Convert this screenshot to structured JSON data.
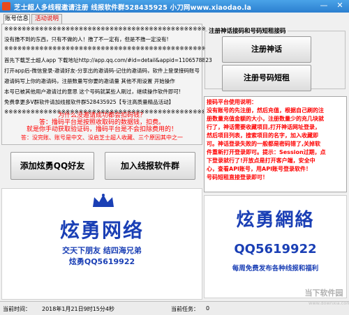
{
  "window": {
    "title": "芝士超人多线程邀请注册    线报软件群528435925    小刀网www.xiaodao.la",
    "minimize_glyph": "—",
    "close_glyph": "✕"
  },
  "tabs": [
    {
      "label": "账号信息"
    },
    {
      "label": "活动说明"
    }
  ],
  "left_panel": {
    "lines": [
      "※※※※※※※※※※※※※※※※※※※※※※※※※※※※※※※※※※※※※※※※※※※※※※",
      "没有撸不到的东西，只有不做的人！撸了不一定有，但是不撸一定没有!",
      "※※※※※※※※※※※※※※※※※※※※※※※※※※※※※※※※※※※※※※※※※※※※※※",
      "首先下载芝士超人app 下载地址http://app.qq.com/#id=detail&appid=1106578823",
      "打开app后-微信登录-邀请好友-分享出的邀请码-记住的邀请码，软件上登录接码账号",
      "邀请码写上你的邀请码，注册数量写你要的邀请量 其他不用设置 开始操作",
      "本号已被其他用户邀请过的意思 这个号码就某些人刷过，继续操作软件即可!",
      "免费拿更多V群软件请加线报软件群528435925【专注高质量精品活动】",
      "※※※※※※※※※※※※※※※※※※※※※※※※※※※※※※※※※※※※※※※※※※※※※※"
    ]
  },
  "ads": [
    "为什么没邀请成功都会扣码钱？",
    "答：撸码平台是按照收取码的数据钱，扣费。",
    "就是你手动获取验证码，撸码平台是不会扣除费用的！",
    "答：没完账、账号是中文、没启芝士超人收藏、三个原因其中之一"
  ],
  "buttons": {
    "add_qq": "添加炫勇QQ好友",
    "join_group": "加入线报软件群",
    "register": "注册神话",
    "register_sms": "注册号码短租"
  },
  "register_group": {
    "legend": "注册神话接码和号码短租接码"
  },
  "help": {
    "lines": [
      "接码平台使用说明：",
      "没有账号的先注册，然后充值，根据自己刷的注",
      "册数量充值金额的大小，注册数量少的充几块就",
      "行了，神话需要收藏项目,打开神话网址登录，",
      "然后项目列表，搜索项目的名字，加入收藏即",
      "可。神话登录失败的一般都是密码错了,关掉软",
      "件重新打开登录即可。提示：Session过期，点",
      "下登录就行了!开放点是打开客户端，安全中",
      "心，查看API账号，用API账号登录软件！",
      "号码短租直接登录即可！"
    ]
  },
  "banners": {
    "left_title": "炫勇网络",
    "left_slogan": "交天下朋友  结四海兄弟",
    "left_qq": "炫勇QQ5619922",
    "right_title": "炫勇網絡",
    "right_qq": "QQ5619922",
    "right_slogan": "每周免费发布各种线报和福利"
  },
  "status": {
    "time_label": "当前时间：",
    "time_value": "2018年1月21日9时15分4秒",
    "tasks_label": "当前任务：",
    "tasks_value": "0"
  },
  "watermark": {
    "brand": "当下软件园",
    "site": "www.downxia.com"
  },
  "colors": {
    "titlebar": "#2b7fd0",
    "alert_red": "#ff0000",
    "banner_blue": "#1a3fb5"
  }
}
